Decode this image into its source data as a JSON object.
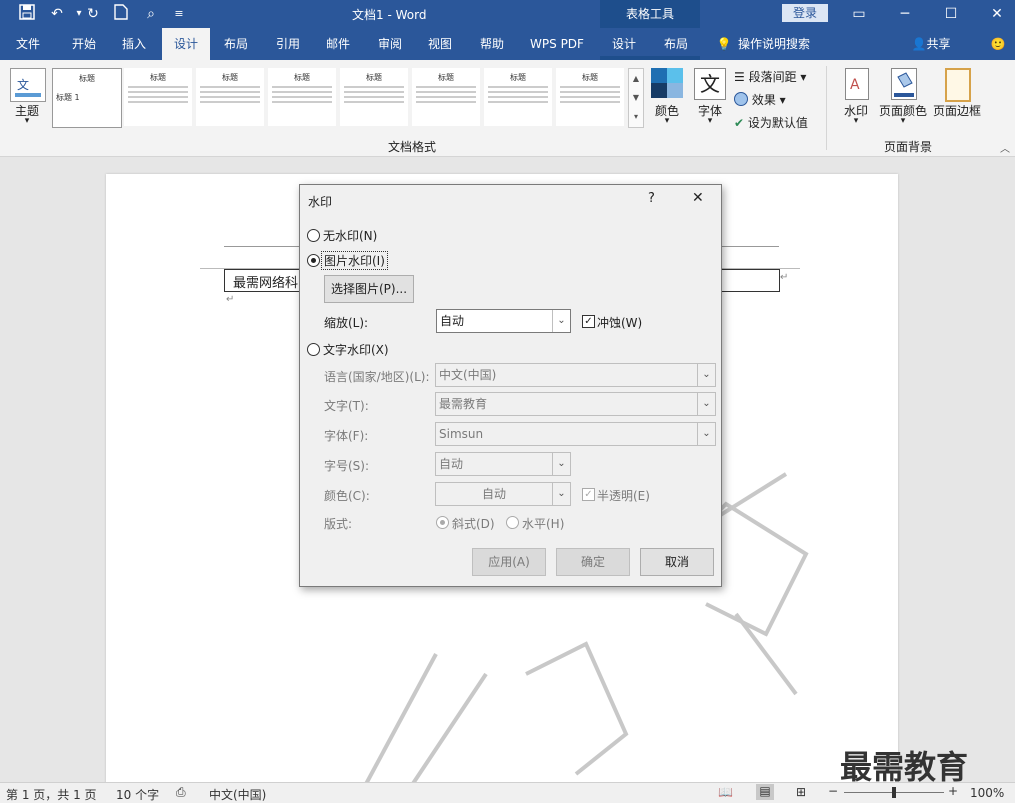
{
  "titlebar": {
    "doc_title": "文档1 - Word",
    "context_tools": "表格工具",
    "login": "登录"
  },
  "tabs": [
    "文件",
    "开始",
    "插入",
    "设计",
    "布局",
    "引用",
    "邮件",
    "审阅",
    "视图",
    "帮助",
    "WPS PDF"
  ],
  "context_tabs": [
    "设计",
    "布局"
  ],
  "search_tab": "操作说明搜索",
  "share": "共享",
  "ribbon": {
    "theme_label": "主题",
    "doc_format_label": "文档格式",
    "style_thumbs": [
      "标题",
      "标题",
      "标题",
      "标题",
      "标题",
      "标题",
      "标题",
      "标题"
    ],
    "first_thumb_heading": "标题 1",
    "colors_label": "颜色",
    "fonts_label": "字体",
    "paragraph_spacing": "段落间距",
    "effects": "效果",
    "set_default": "设为默认值",
    "watermark_label": "水印",
    "page_color_label": "页面颜色",
    "page_border_label": "页面边框",
    "page_background_group": "页面背景"
  },
  "document": {
    "textbox_text": "最需网络科",
    "watermark_brand": "最需教育"
  },
  "status": {
    "page": "第 1 页，共 1 页",
    "words": "10 个字",
    "language": "中文(中国)",
    "zoom": "100%"
  },
  "dialog": {
    "title": "水印",
    "help": "?",
    "close": "✕",
    "no_watermark": "无水印(N)",
    "picture_watermark": "图片水印(I)",
    "select_picture": "选择图片(P)...",
    "scale_label": "缩放(L):",
    "scale_value": "自动",
    "washout": "冲蚀(W)",
    "text_watermark": "文字水印(X)",
    "language_label": "语言(国家/地区)(L):",
    "language_value": "中文(中国)",
    "text_label": "文字(T):",
    "text_value": "最需教育",
    "font_label": "字体(F):",
    "font_value": "Simsun",
    "size_label": "字号(S):",
    "size_value": "自动",
    "color_label": "颜色(C):",
    "color_value": "自动",
    "semitransparent": "半透明(E)",
    "layout_label": "版式:",
    "diagonal": "斜式(D)",
    "horizontal": "水平(H)",
    "apply": "应用(A)",
    "ok": "确定",
    "cancel": "取消"
  },
  "colors": {
    "accent": "#2b579a",
    "context": "#1e4e8c"
  }
}
